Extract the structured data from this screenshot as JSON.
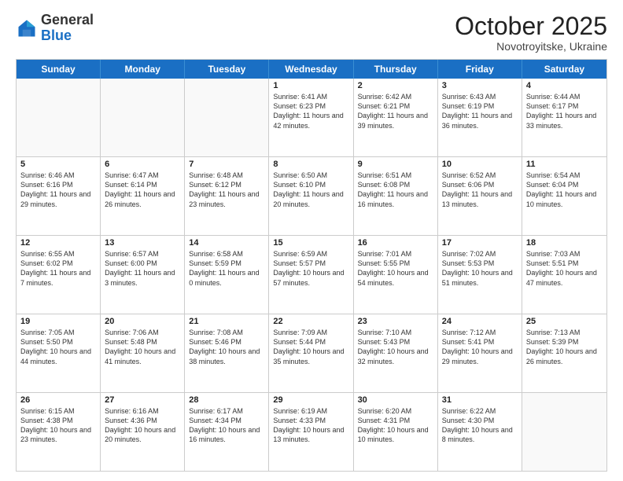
{
  "logo": {
    "general": "General",
    "blue": "Blue"
  },
  "header": {
    "month": "October 2025",
    "location": "Novotroyitske, Ukraine"
  },
  "weekdays": [
    "Sunday",
    "Monday",
    "Tuesday",
    "Wednesday",
    "Thursday",
    "Friday",
    "Saturday"
  ],
  "weeks": [
    [
      {
        "day": "",
        "sunrise": "",
        "sunset": "",
        "daylight": "",
        "empty": true
      },
      {
        "day": "",
        "sunrise": "",
        "sunset": "",
        "daylight": "",
        "empty": true
      },
      {
        "day": "",
        "sunrise": "",
        "sunset": "",
        "daylight": "",
        "empty": true
      },
      {
        "day": "1",
        "sunrise": "Sunrise: 6:41 AM",
        "sunset": "Sunset: 6:23 PM",
        "daylight": "Daylight: 11 hours and 42 minutes."
      },
      {
        "day": "2",
        "sunrise": "Sunrise: 6:42 AM",
        "sunset": "Sunset: 6:21 PM",
        "daylight": "Daylight: 11 hours and 39 minutes."
      },
      {
        "day": "3",
        "sunrise": "Sunrise: 6:43 AM",
        "sunset": "Sunset: 6:19 PM",
        "daylight": "Daylight: 11 hours and 36 minutes."
      },
      {
        "day": "4",
        "sunrise": "Sunrise: 6:44 AM",
        "sunset": "Sunset: 6:17 PM",
        "daylight": "Daylight: 11 hours and 33 minutes."
      }
    ],
    [
      {
        "day": "5",
        "sunrise": "Sunrise: 6:46 AM",
        "sunset": "Sunset: 6:16 PM",
        "daylight": "Daylight: 11 hours and 29 minutes."
      },
      {
        "day": "6",
        "sunrise": "Sunrise: 6:47 AM",
        "sunset": "Sunset: 6:14 PM",
        "daylight": "Daylight: 11 hours and 26 minutes."
      },
      {
        "day": "7",
        "sunrise": "Sunrise: 6:48 AM",
        "sunset": "Sunset: 6:12 PM",
        "daylight": "Daylight: 11 hours and 23 minutes."
      },
      {
        "day": "8",
        "sunrise": "Sunrise: 6:50 AM",
        "sunset": "Sunset: 6:10 PM",
        "daylight": "Daylight: 11 hours and 20 minutes."
      },
      {
        "day": "9",
        "sunrise": "Sunrise: 6:51 AM",
        "sunset": "Sunset: 6:08 PM",
        "daylight": "Daylight: 11 hours and 16 minutes."
      },
      {
        "day": "10",
        "sunrise": "Sunrise: 6:52 AM",
        "sunset": "Sunset: 6:06 PM",
        "daylight": "Daylight: 11 hours and 13 minutes."
      },
      {
        "day": "11",
        "sunrise": "Sunrise: 6:54 AM",
        "sunset": "Sunset: 6:04 PM",
        "daylight": "Daylight: 11 hours and 10 minutes."
      }
    ],
    [
      {
        "day": "12",
        "sunrise": "Sunrise: 6:55 AM",
        "sunset": "Sunset: 6:02 PM",
        "daylight": "Daylight: 11 hours and 7 minutes."
      },
      {
        "day": "13",
        "sunrise": "Sunrise: 6:57 AM",
        "sunset": "Sunset: 6:00 PM",
        "daylight": "Daylight: 11 hours and 3 minutes."
      },
      {
        "day": "14",
        "sunrise": "Sunrise: 6:58 AM",
        "sunset": "Sunset: 5:59 PM",
        "daylight": "Daylight: 11 hours and 0 minutes."
      },
      {
        "day": "15",
        "sunrise": "Sunrise: 6:59 AM",
        "sunset": "Sunset: 5:57 PM",
        "daylight": "Daylight: 10 hours and 57 minutes."
      },
      {
        "day": "16",
        "sunrise": "Sunrise: 7:01 AM",
        "sunset": "Sunset: 5:55 PM",
        "daylight": "Daylight: 10 hours and 54 minutes."
      },
      {
        "day": "17",
        "sunrise": "Sunrise: 7:02 AM",
        "sunset": "Sunset: 5:53 PM",
        "daylight": "Daylight: 10 hours and 51 minutes."
      },
      {
        "day": "18",
        "sunrise": "Sunrise: 7:03 AM",
        "sunset": "Sunset: 5:51 PM",
        "daylight": "Daylight: 10 hours and 47 minutes."
      }
    ],
    [
      {
        "day": "19",
        "sunrise": "Sunrise: 7:05 AM",
        "sunset": "Sunset: 5:50 PM",
        "daylight": "Daylight: 10 hours and 44 minutes."
      },
      {
        "day": "20",
        "sunrise": "Sunrise: 7:06 AM",
        "sunset": "Sunset: 5:48 PM",
        "daylight": "Daylight: 10 hours and 41 minutes."
      },
      {
        "day": "21",
        "sunrise": "Sunrise: 7:08 AM",
        "sunset": "Sunset: 5:46 PM",
        "daylight": "Daylight: 10 hours and 38 minutes."
      },
      {
        "day": "22",
        "sunrise": "Sunrise: 7:09 AM",
        "sunset": "Sunset: 5:44 PM",
        "daylight": "Daylight: 10 hours and 35 minutes."
      },
      {
        "day": "23",
        "sunrise": "Sunrise: 7:10 AM",
        "sunset": "Sunset: 5:43 PM",
        "daylight": "Daylight: 10 hours and 32 minutes."
      },
      {
        "day": "24",
        "sunrise": "Sunrise: 7:12 AM",
        "sunset": "Sunset: 5:41 PM",
        "daylight": "Daylight: 10 hours and 29 minutes."
      },
      {
        "day": "25",
        "sunrise": "Sunrise: 7:13 AM",
        "sunset": "Sunset: 5:39 PM",
        "daylight": "Daylight: 10 hours and 26 minutes."
      }
    ],
    [
      {
        "day": "26",
        "sunrise": "Sunrise: 6:15 AM",
        "sunset": "Sunset: 4:38 PM",
        "daylight": "Daylight: 10 hours and 23 minutes."
      },
      {
        "day": "27",
        "sunrise": "Sunrise: 6:16 AM",
        "sunset": "Sunset: 4:36 PM",
        "daylight": "Daylight: 10 hours and 20 minutes."
      },
      {
        "day": "28",
        "sunrise": "Sunrise: 6:17 AM",
        "sunset": "Sunset: 4:34 PM",
        "daylight": "Daylight: 10 hours and 16 minutes."
      },
      {
        "day": "29",
        "sunrise": "Sunrise: 6:19 AM",
        "sunset": "Sunset: 4:33 PM",
        "daylight": "Daylight: 10 hours and 13 minutes."
      },
      {
        "day": "30",
        "sunrise": "Sunrise: 6:20 AM",
        "sunset": "Sunset: 4:31 PM",
        "daylight": "Daylight: 10 hours and 10 minutes."
      },
      {
        "day": "31",
        "sunrise": "Sunrise: 6:22 AM",
        "sunset": "Sunset: 4:30 PM",
        "daylight": "Daylight: 10 hours and 8 minutes."
      },
      {
        "day": "",
        "sunrise": "",
        "sunset": "",
        "daylight": "",
        "empty": true
      }
    ]
  ]
}
